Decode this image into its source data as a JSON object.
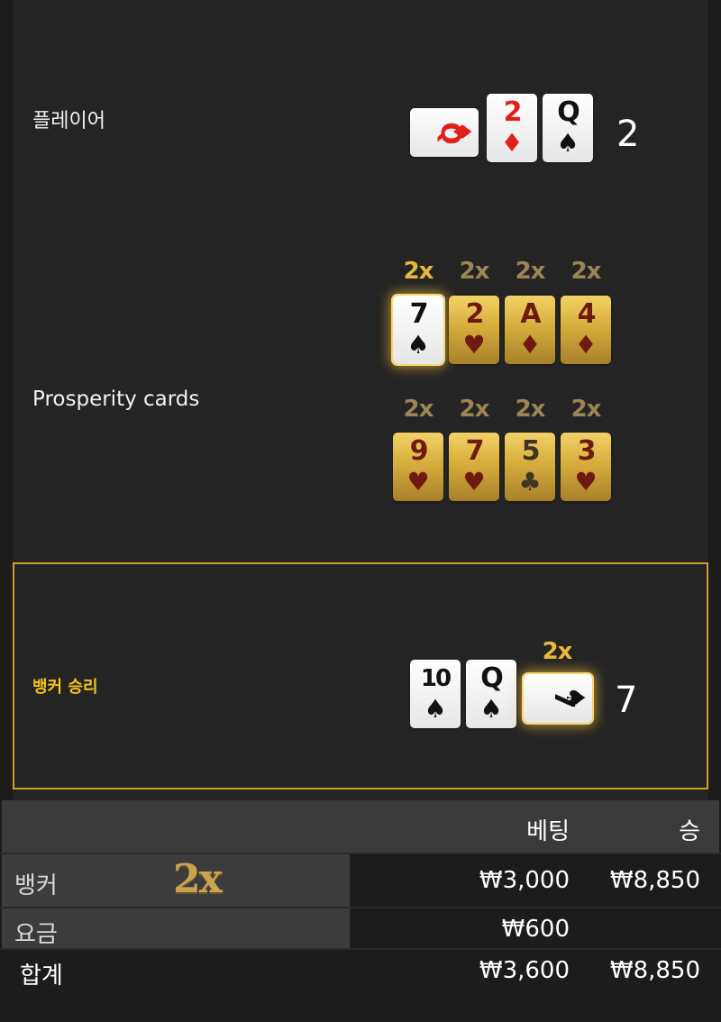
{
  "player": {
    "label": "플레이어",
    "score": "2",
    "cards": [
      {
        "rank": "Q",
        "suit": "♦",
        "color": "red",
        "orientation": "sideways"
      },
      {
        "rank": "2",
        "suit": "♦",
        "color": "red"
      },
      {
        "rank": "Q",
        "suit": "♠",
        "color": "black"
      }
    ]
  },
  "prosperity": {
    "label": "Prosperity cards",
    "row1": [
      {
        "mult": "2x",
        "rank": "7",
        "suit": "♠",
        "color": "black",
        "style": "white-glow"
      },
      {
        "mult": "2x",
        "rank": "2",
        "suit": "♥",
        "color": "red",
        "style": "gold"
      },
      {
        "mult": "2x",
        "rank": "A",
        "suit": "♦",
        "color": "red",
        "style": "gold"
      },
      {
        "mult": "2x",
        "rank": "4",
        "suit": "♦",
        "color": "red",
        "style": "gold"
      }
    ],
    "row2": [
      {
        "mult": "2x",
        "rank": "9",
        "suit": "♥",
        "color": "red",
        "style": "gold"
      },
      {
        "mult": "2x",
        "rank": "7",
        "suit": "♥",
        "color": "red",
        "style": "gold"
      },
      {
        "mult": "2x",
        "rank": "5",
        "suit": "♣",
        "color": "black",
        "style": "gold"
      },
      {
        "mult": "2x",
        "rank": "3",
        "suit": "♥",
        "color": "red",
        "style": "gold"
      }
    ]
  },
  "banker": {
    "label": "뱅커 승리",
    "score": "7",
    "cards": [
      {
        "rank": "10",
        "suit": "♠",
        "color": "black"
      },
      {
        "rank": "Q",
        "suit": "♠",
        "color": "black"
      },
      {
        "rank": "7",
        "suit": "♠",
        "color": "black",
        "orientation": "sideways",
        "mult": "2x"
      }
    ]
  },
  "summary": {
    "header": {
      "bet": "베팅",
      "win": "승"
    },
    "rows": [
      {
        "label": "뱅커",
        "multiplier": "2x",
        "bet": "₩3,000",
        "win": "₩8,850"
      },
      {
        "label": "요금",
        "bet": "₩600",
        "win": ""
      },
      {
        "label": "합계",
        "bet": "₩3,600",
        "win": "₩8,850"
      }
    ]
  },
  "colors": {
    "accent_gold": "#c9a227",
    "winner_label": "#f5c518",
    "multiplier": "#e8b83a",
    "card_red": "#e0201c"
  }
}
